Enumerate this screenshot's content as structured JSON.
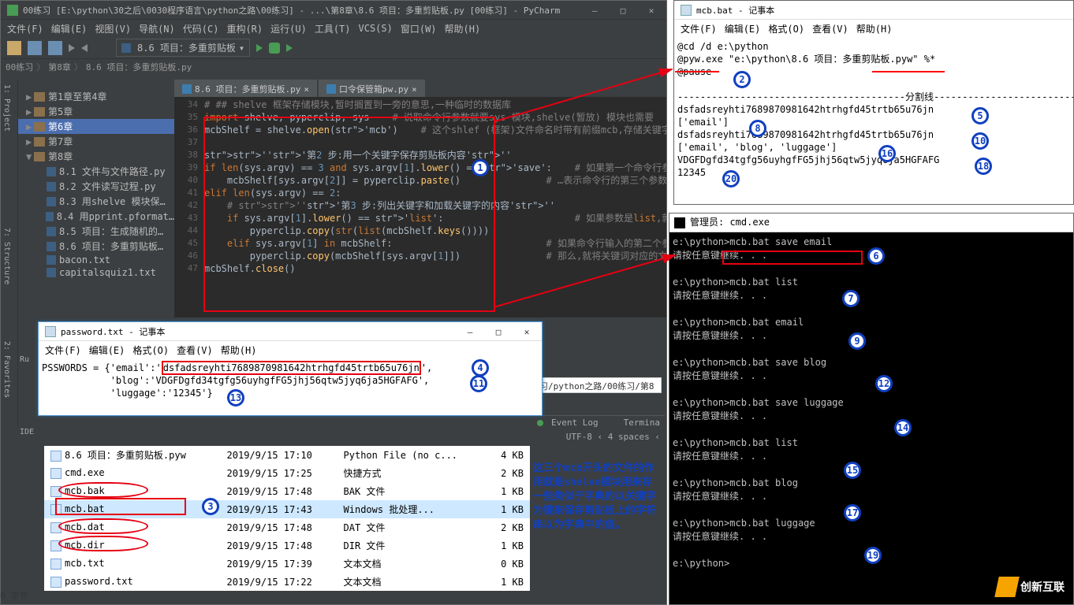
{
  "pycharm": {
    "title": "00练习 [E:\\python\\30之后\\0030程序语言\\python之路\\00练习] - ...\\第8章\\8.6 项目：多重剪贴板.py [00练习] - PyCharm",
    "menus": [
      "文件(F)",
      "编辑(E)",
      "视图(V)",
      "导航(N)",
      "代码(C)",
      "重构(R)",
      "运行(U)",
      "工具(T)",
      "VCS(S)",
      "窗口(W)",
      "帮助(H)"
    ],
    "run_config": "8.6 项目：多重剪贴板",
    "breadcrumbs": [
      "00练习",
      "第8章",
      "8.6 项目：多重剪贴板.py"
    ],
    "tree": [
      {
        "label": "第1章至第4章",
        "arrow": "▶"
      },
      {
        "label": "第5章",
        "arrow": "▶"
      },
      {
        "label": "第6章",
        "arrow": "▶",
        "sel": true
      },
      {
        "label": "第7章",
        "arrow": "▶"
      },
      {
        "label": "第8章",
        "arrow": "▼"
      },
      {
        "label": "8.1 文件与文件路径.py",
        "indent": 1,
        "file": true
      },
      {
        "label": "8.2 文件读写过程.py",
        "indent": 1,
        "file": true
      },
      {
        "label": "8.3 用shelve 模块保…",
        "indent": 1,
        "file": true
      },
      {
        "label": "8.4 用pprint.pformat…",
        "indent": 1,
        "file": true
      },
      {
        "label": "8.5 项目：生成随机的…",
        "indent": 1,
        "file": true
      },
      {
        "label": "8.6 项目：多重剪贴板…",
        "indent": 1,
        "file": true
      },
      {
        "label": "bacon.txt",
        "indent": 1,
        "file": true
      },
      {
        "label": "capitalsquiz1.txt",
        "indent": 1,
        "file": true
      }
    ],
    "tabs": [
      "8.6 项目：多重剪贴板.py",
      "口令保管箱pw.py"
    ],
    "line_numbers": [
      34,
      35,
      36,
      37,
      38,
      39,
      40,
      41,
      42,
      43,
      44,
      45,
      46,
      47
    ],
    "code_lines": [
      "# ## shelve 框架存储模块,暂时搁置到一旁的意思,一种临时的数据库",
      "import shelve, pyperclip, sys    # 说取命令行参数就要sys 模块,shelve(暂放) 模块也需要",
      "mcbShelf = shelve.open('mcb')    # 这个shlef (框架)文件命名时带有前缀mcb,存储关键字的一",
      "",
      "'''第2 步:用一个关键字保存剪贴板内容'''",
      "if len(sys.argv) == 3 and sys.argv[1].lower() == 'save':    # 如果第一个命令行参数(它总是在…",
      "    mcbShelf[sys.argv[2]] = pyperclip.paste()               # …表示命令行的第三个参数sys.arg",
      "elif len(sys.argv) == 2:",
      "    # '''第3 步:列出关键字和加载关键字的内容'''",
      "    if sys.argv[1].lower() == 'list':                       # 如果参数是list,就将所有的关键…",
      "        pyperclip.copy(str(list(mcbShelf.keys())))",
      "    elif sys.argv[1] in mcbShelf:                           # 如果命令行输入的第二个参数在mcb",
      "        pyperclip.copy(mcbShelf[sys.argv[1]])               # 那么,就将关键词对应的文本拷贝…",
      "mcbShelf.close()"
    ],
    "status_right": "UTF-8 ‹  4 spaces ‹",
    "event_log": "Event Log",
    "terminal": "Termina",
    "path_hint": "习/python之路/00练习/第8章",
    "side_tabs": [
      "1: Project",
      "7: Structure",
      "2: Favorites"
    ],
    "run_label": "Ru"
  },
  "notepad1": {
    "title": "mcb.bat - 记事本",
    "menus": [
      "文件(F)",
      "编辑(E)",
      "格式(O)",
      "查看(V)",
      "帮助(H)"
    ],
    "content": "@cd /d e:\\python\n@pyw.exe \"e:\\python\\8.6 项目：多重剪贴板.pyw\" %*\n@pause\n\n----------------------------------------分割线-----------------------------------------\ndsfadsreyhti7689870981642htrhgfd45trtb65u76jn\n['email']\ndsfadsreyhti7689870981642htrhgfd45trtb65u76jn\n['email', 'blog', 'luggage']\nVDGFDgfd34tgfg56uyhgfFG5jhj56qtw5jyq6ja5HGFAFG\n12345"
  },
  "cmd": {
    "title": "管理员: cmd.exe",
    "lines": [
      "e:\\python>mcb.bat save email",
      "请按任意键继续. . .",
      "",
      "e:\\python>mcb.bat list",
      "请按任意键继续. . .",
      "",
      "e:\\python>mcb.bat email",
      "请按任意键继续. . .",
      "",
      "e:\\python>mcb.bat save blog",
      "请按任意键继续. . .",
      "",
      "e:\\python>mcb.bat save luggage",
      "请按任意键继续. . .",
      "",
      "e:\\python>mcb.bat list",
      "请按任意键继续. . .",
      "",
      "e:\\python>mcb.bat blog",
      "请按任意键继续. . .",
      "",
      "e:\\python>mcb.bat luggage",
      "请按任意键继续. . .",
      "",
      "e:\\python>"
    ]
  },
  "pwwin": {
    "title": "password.txt - 记事本",
    "menus": [
      "文件(F)",
      "编辑(E)",
      "格式(O)",
      "查看(V)",
      "帮助(H)"
    ],
    "l1": "PSSWORDS = {'email':'",
    "l1h": "dsfadsreyhti7689870981642htrhgfd45trtb65u76jn",
    "l1e": "',",
    "l2": "            'blog':'VDGFDgfd34tgfg56uyhgfFG5jhj56qtw5jyq6ja5HGFAFG',",
    "l3": "            'luggage':'12345'}"
  },
  "files": [
    {
      "name": "8.6 项目：多重剪贴板.pyw",
      "date": "2019/9/15 17:10",
      "type": "Python File (no c...",
      "size": "4 KB"
    },
    {
      "name": "cmd.exe",
      "date": "2019/9/15 17:25",
      "type": "快捷方式",
      "size": "2 KB"
    },
    {
      "name": "mcb.bak",
      "date": "2019/9/15 17:48",
      "type": "BAK 文件",
      "size": "1 KB"
    },
    {
      "name": "mcb.bat",
      "date": "2019/9/15 17:43",
      "type": "Windows 批处理...",
      "size": "1 KB",
      "sel": true
    },
    {
      "name": "mcb.dat",
      "date": "2019/9/15 17:48",
      "type": "DAT 文件",
      "size": "2 KB"
    },
    {
      "name": "mcb.dir",
      "date": "2019/9/15 17:48",
      "type": "DIR 文件",
      "size": "1 KB"
    },
    {
      "name": "mcb.txt",
      "date": "2019/9/15 17:39",
      "type": "文本文档",
      "size": "0 KB"
    },
    {
      "name": "password.txt",
      "date": "2019/9/15 17:22",
      "type": "文本文档",
      "size": "1 KB"
    }
  ],
  "blue_anno": "这三个mcb开头的文件的作用就是shelve模块用来存一些类似于字典的以关键字为键来保存剪贴板上的字符串以为字典中的值。",
  "bytes": "0 字节",
  "logo": "创新互联",
  "callouts": {
    "1": "1",
    "2": "2",
    "3": "3",
    "4": "4",
    "5": "5",
    "6": "6",
    "7": "7",
    "8": "8",
    "9": "9",
    "10": "10",
    "11": "11",
    "12": "12",
    "13": "13",
    "14": "14",
    "15": "15",
    "16": "16",
    "17": "17",
    "18": "18",
    "19": "19",
    "20": "20"
  }
}
